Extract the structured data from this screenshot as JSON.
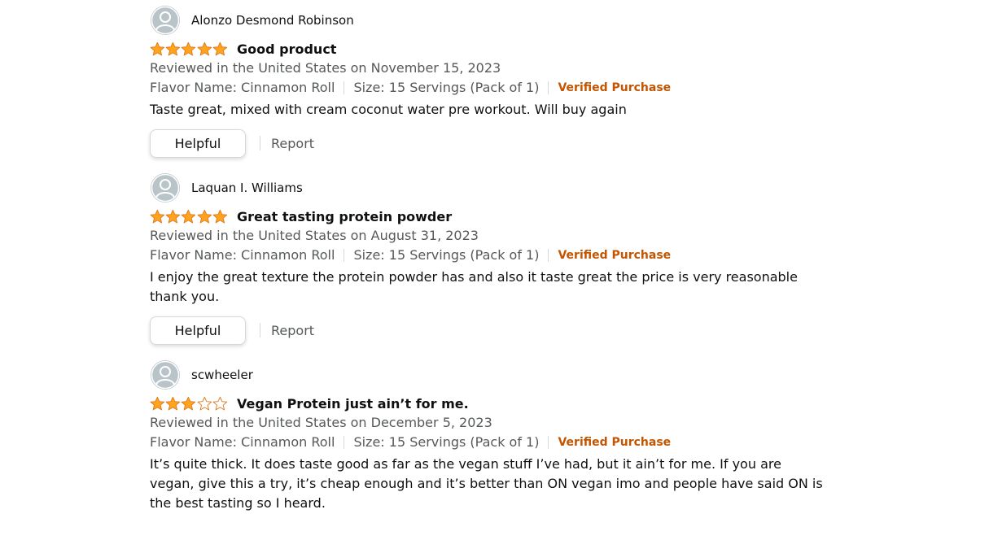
{
  "colors": {
    "star_fill": "#ffa41c",
    "star_stroke": "#de7921",
    "verified": "#c45500",
    "secondary_text": "#565959",
    "avatar_bg": "#b9c4c9"
  },
  "reviews": [
    {
      "profile_name": "Alonzo Desmond Robinson",
      "rating": 5,
      "title": "Good product",
      "date": "Reviewed in the United States on November 15, 2023",
      "flavor": "Flavor Name: Cinnamon Roll",
      "size": "Size: 15 Servings (Pack of 1)",
      "verified": "Verified Purchase",
      "body": "Taste great, mixed with cream coconut water pre workout. Will buy again",
      "helpful_label": "Helpful",
      "report_label": "Report"
    },
    {
      "profile_name": "Laquan I. Williams",
      "rating": 5,
      "title": "Great tasting protein powder",
      "date": "Reviewed in the United States on August 31, 2023",
      "flavor": "Flavor Name: Cinnamon Roll",
      "size": "Size: 15 Servings (Pack of 1)",
      "verified": "Verified Purchase",
      "body": "I enjoy the great texture the protein powder has and also it taste great the price is very reasonable thank you.",
      "helpful_label": "Helpful",
      "report_label": "Report"
    },
    {
      "profile_name": "scwheeler",
      "rating": 3,
      "title": "Vegan Protein just ain’t for me.",
      "date": "Reviewed in the United States on December 5, 2023",
      "flavor": "Flavor Name: Cinnamon Roll",
      "size": "Size: 15 Servings (Pack of 1)",
      "verified": "Verified Purchase",
      "body": "It’s quite thick. It does taste good as far as the vegan stuff I’ve had, but it ain’t for me. If you are vegan, give this a try, it’s cheap enough and it’s better than ON vegan imo and people have said ON is the best tasting so I heard."
    }
  ]
}
